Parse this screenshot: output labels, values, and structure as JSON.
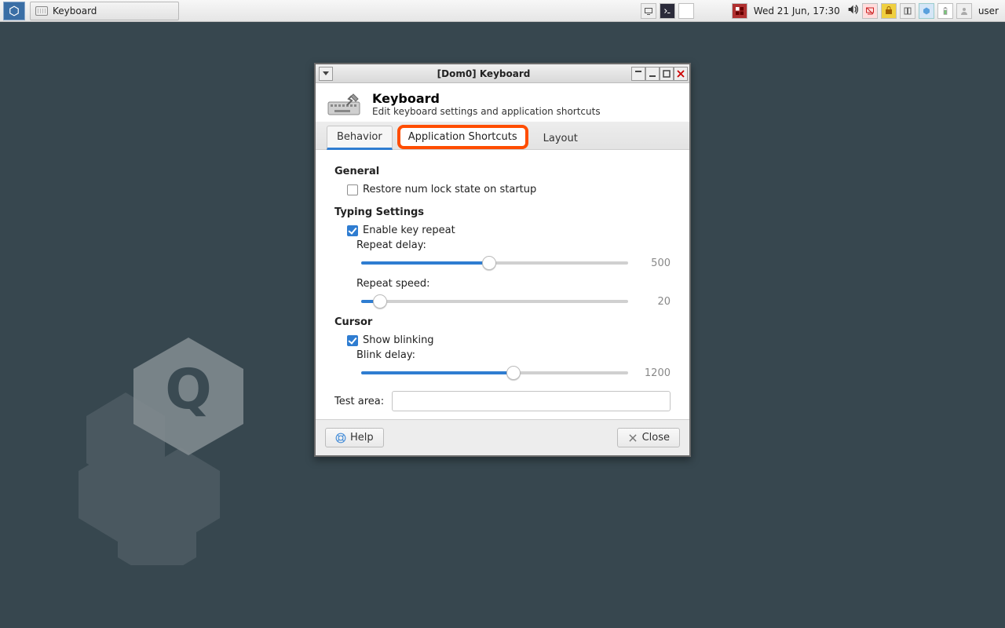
{
  "panel": {
    "task_label": "Keyboard",
    "datetime": "Wed 21 Jun, 17:30",
    "username": "user"
  },
  "window": {
    "title": "[Dom0] Keyboard",
    "header_title": "Keyboard",
    "header_sub": "Edit keyboard settings and application shortcuts",
    "tabs": {
      "behavior": "Behavior",
      "shortcuts": "Application Shortcuts",
      "layout": "Layout"
    },
    "sections": {
      "general": "General",
      "restore_numlock": "Restore num lock state on startup",
      "typing": "Typing Settings",
      "enable_repeat": "Enable key repeat",
      "repeat_delay": "Repeat delay:",
      "repeat_speed": "Repeat speed:",
      "cursor": "Cursor",
      "show_blink": "Show blinking",
      "blink_delay": "Blink delay:",
      "test_area": "Test area:"
    },
    "values": {
      "repeat_delay": "500",
      "repeat_speed": "20",
      "blink_delay": "1200"
    },
    "buttons": {
      "help": "Help",
      "close": "Close"
    }
  }
}
